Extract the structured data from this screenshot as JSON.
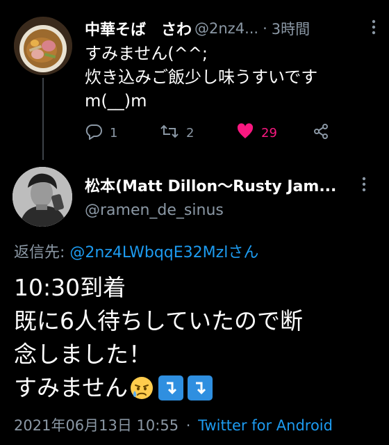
{
  "parent_tweet": {
    "display_name": "中華そば　さわ",
    "handle": "@2nz4...",
    "separator": "·",
    "time": "3時間",
    "text_lines": [
      "すみません(^^;",
      "炊き込みご飯少し味うすいです",
      "m(__)m"
    ],
    "replies": "1",
    "retweets": "2",
    "likes": "29",
    "liked": true
  },
  "reply_tweet": {
    "display_name": "松本(Matt Dillon〜Rusty Jam...",
    "handle": "@ramen_de_sinus",
    "reply_label": "返信先: ",
    "reply_mention": "@2nz4LWbqqE32Mzlさん",
    "text_lines": [
      "10:30到着",
      "既に6人待ちしていたので断",
      "念しました！",
      "すみません"
    ],
    "emojis": [
      "crying-face-icon",
      "arrow-down-icon",
      "arrow-down-icon"
    ],
    "date": "2021年06月13日 10:55",
    "separator": "·",
    "client": "Twitter for Android"
  },
  "colors": {
    "background": "#000000",
    "secondary_text": "#8b98a5",
    "link": "#1d9bf0",
    "like": "#f91880"
  }
}
